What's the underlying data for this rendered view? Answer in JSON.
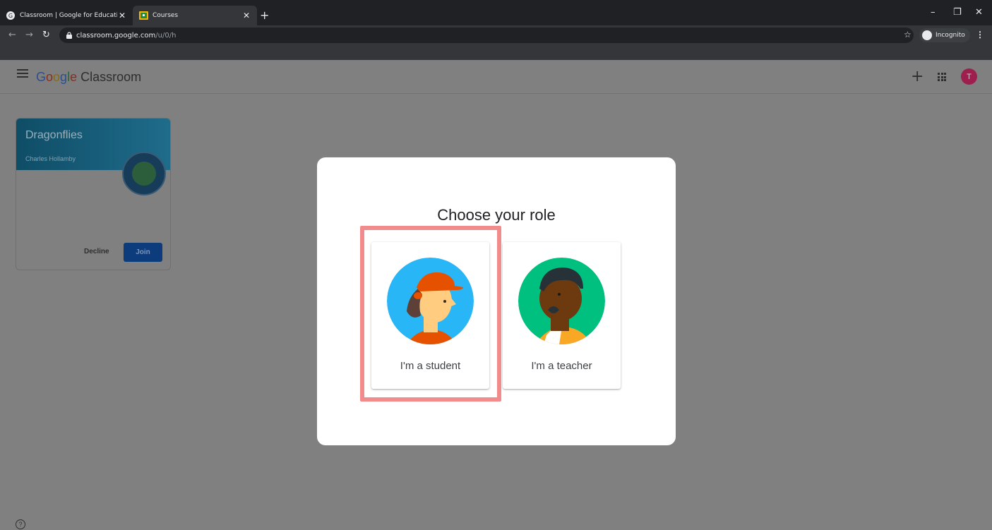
{
  "browser": {
    "tabs": [
      {
        "title": "Classroom | Google for Educatio",
        "active": false
      },
      {
        "title": "Courses",
        "active": true
      }
    ],
    "new_tab": "+",
    "address": {
      "host": "classroom.google.com",
      "path": "/u/0/h"
    },
    "incognito_label": "Incognito",
    "window_controls": [
      "–",
      "❐",
      "✕"
    ]
  },
  "app": {
    "logo": {
      "google": "Google",
      "product": "Classroom"
    },
    "avatar_initial": "T"
  },
  "class_card": {
    "title": "Dragonflies",
    "teacher": "Charles Hollamby",
    "decline_label": "Decline",
    "join_label": "Join"
  },
  "dialog": {
    "title": "Choose your role",
    "roles": [
      {
        "label": "I'm a student",
        "icon": "student-avatar-icon"
      },
      {
        "label": "I'm a teacher",
        "icon": "teacher-avatar-icon"
      }
    ]
  },
  "help_icon": "?",
  "colors": {
    "overlay": "#808080",
    "highlight": "#f28b8b",
    "dialog_bg": "#ffffff"
  }
}
